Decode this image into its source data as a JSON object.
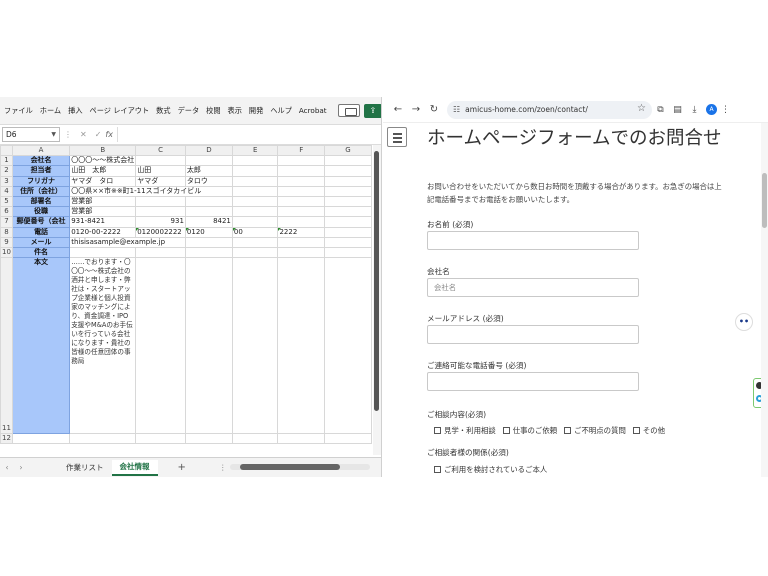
{
  "spreadsheet": {
    "menu": [
      "ファイル",
      "ホーム",
      "挿入",
      "ページ レイアウト",
      "数式",
      "データ",
      "校閲",
      "表示",
      "開発",
      "ヘルプ",
      "Acrobat"
    ],
    "name_box": "D6",
    "columns": [
      "A",
      "B",
      "C",
      "D",
      "E",
      "F",
      "G"
    ],
    "rows": [
      {
        "n": "1",
        "label": "会社名",
        "cells": [
          "〇〇〇～～株式会社",
          "",
          "",
          "",
          "",
          ""
        ]
      },
      {
        "n": "2",
        "label": "担当者",
        "cells": [
          "山田　太郎",
          "山田",
          "太郎",
          "",
          "",
          ""
        ]
      },
      {
        "n": "3",
        "label": "フリガナ",
        "cells": [
          "ヤマダ　タロ",
          "ヤマダ",
          "タロウ",
          "",
          "",
          ""
        ]
      },
      {
        "n": "4",
        "label": "住所（会社）",
        "cells": [
          "〇〇県××市※※町1-11スゴイタカイビル",
          "",
          "",
          "",
          "",
          ""
        ]
      },
      {
        "n": "5",
        "label": "部署名",
        "cells": [
          "営業部",
          "",
          "",
          "",
          "",
          ""
        ]
      },
      {
        "n": "6",
        "label": "役職",
        "cells": [
          "営業部",
          "",
          "",
          "",
          "",
          ""
        ]
      },
      {
        "n": "7",
        "label": "郵便番号（会社",
        "cells": [
          "931-8421",
          "931",
          "8421",
          "",
          "",
          ""
        ]
      },
      {
        "n": "8",
        "label": "電話",
        "cells": [
          "0120-00-2222",
          "0120002222",
          "0120",
          "00",
          "2222",
          ""
        ]
      },
      {
        "n": "9",
        "label": "メール",
        "cells": [
          "thisisasample@example.jp",
          "",
          "",
          "",
          "",
          ""
        ]
      },
      {
        "n": "10",
        "label": "件名",
        "cells": [
          "",
          "",
          "",
          "",
          "",
          ""
        ]
      },
      {
        "n": "11",
        "label": "本文",
        "cells": [
          "",
          "",
          "",
          "",
          "",
          ""
        ]
      },
      {
        "n": "12",
        "label": "",
        "cells": [
          "",
          "",
          "",
          "",
          "",
          ""
        ]
      }
    ],
    "body_text": "……でおります・〇〇〇～～株式会社の酒井と申します・弊社は・スタートアップ企業様と個人投資家のマッチングにより、資金調達・IPO支援やM&Aのお手伝いを行っている会社になります・貴社の皆様の任意団体の事務局",
    "sheet_tabs": [
      "作業リスト",
      "会社情報"
    ],
    "active_tab": "会社情報"
  },
  "browser": {
    "url": "amicus-home.com/zoen/contact/",
    "avatar_letter": "A",
    "form": {
      "title": "ホームページフォームでのお問合せ",
      "intro": "お問い合わせをいただいてから数日お時間を頂戴する場合があります。お急ぎの場合は上記電話番号までお電話をお願いいたします。",
      "name_label": "お名前 (必須)",
      "company_label": "会社名",
      "company_placeholder": "会社名",
      "email_label": "メールアドレス (必須)",
      "phone_label": "ご連絡可能な電話番号 (必須)",
      "inquiry_label": "ご相談内容(必須)",
      "inquiry_options": [
        "見学・利用相談",
        "仕事のご依頼",
        "ご不明点の質問",
        "その他"
      ],
      "relation_label": "ご相談者様の関係(必須)",
      "relation_option": "ご利用を検討されているご本人"
    }
  }
}
